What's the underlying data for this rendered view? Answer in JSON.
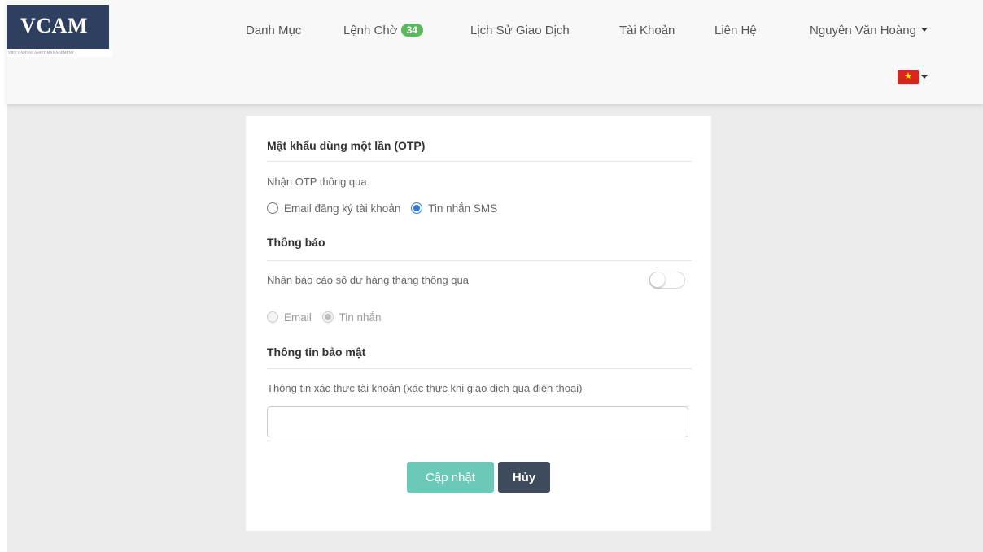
{
  "brand": {
    "name": "VCAM",
    "subtitle": "VIET CAPITAL ASSET MANAGEMENT"
  },
  "nav": {
    "items": [
      {
        "label": "Danh Mục"
      },
      {
        "label": "Lệnh Chờ",
        "badge": "34"
      },
      {
        "label": "Lịch Sử Giao Dịch"
      },
      {
        "label": "Tài Khoản"
      },
      {
        "label": "Liên Hệ"
      }
    ],
    "user": "Nguyễn Văn Hoàng",
    "language_flag": "vietnam-flag-icon"
  },
  "otp": {
    "title": "Mật khẩu dùng một lần (OTP)",
    "receive_label": "Nhận OTP thông qua",
    "options": [
      {
        "label": "Email đăng ký tài khoản",
        "checked": false
      },
      {
        "label": "Tin nhắn SMS",
        "checked": true
      }
    ]
  },
  "notifications": {
    "title": "Thông báo",
    "monthly_label": "Nhận báo cáo số dư hàng tháng thông qua",
    "toggle_on": false,
    "options": [
      {
        "label": "Email",
        "checked": false
      },
      {
        "label": "Tin nhắn",
        "checked": true
      }
    ]
  },
  "security": {
    "title": "Thông tin bảo mật",
    "field_label": "Thông tin xác thực tài khoản (xác thực khi giao dịch qua điện thoại)",
    "value": "",
    "placeholder": ""
  },
  "actions": {
    "update_label": "Cập nhật",
    "cancel_label": "Hủy"
  },
  "colors": {
    "badge": "#5cb85c",
    "update_button": "#6cc9b8",
    "cancel_button": "#3e4b5d",
    "radio_checked": "#2c7be5"
  }
}
